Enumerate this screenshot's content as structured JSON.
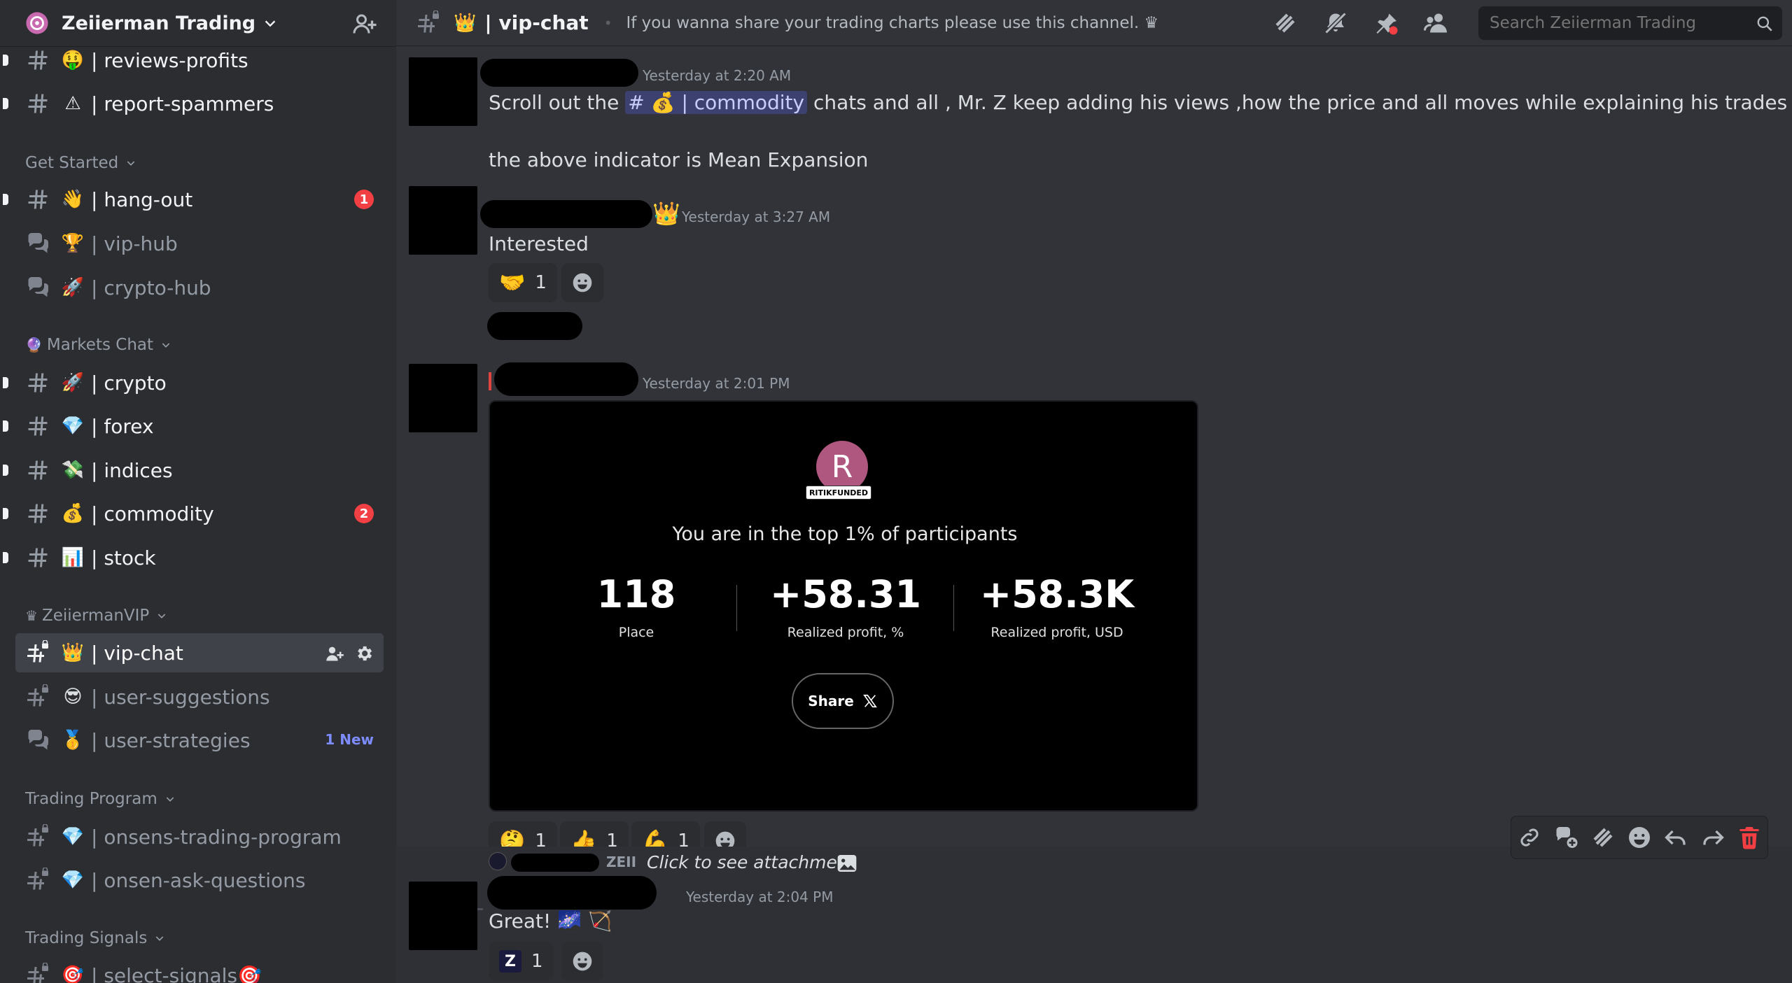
{
  "server": {
    "name": "Zeiierman Trading"
  },
  "sidebar": {
    "channels": [
      {
        "emoji": "🤑",
        "name": "| reviews-profits"
      },
      {
        "emoji": "⚠",
        "name": "| report-spammers"
      },
      {
        "emoji": "👋",
        "name": "| hang-out",
        "badge": "1"
      },
      {
        "emoji": "🏆",
        "name": "| vip-hub"
      },
      {
        "emoji": "🚀",
        "name": "| crypto-hub"
      },
      {
        "emoji": "🚀",
        "name": "| crypto"
      },
      {
        "emoji": "💎",
        "name": "| forex"
      },
      {
        "emoji": "💸",
        "name": "| indices"
      },
      {
        "emoji": "💰",
        "name": "| commodity",
        "badge": "2"
      },
      {
        "emoji": "📊",
        "name": "| stock"
      },
      {
        "emoji": "👑",
        "name": "| vip-chat"
      },
      {
        "emoji": "😎",
        "name": "| user-suggestions"
      },
      {
        "emoji": "🥇",
        "name": "| user-strategies",
        "new_label": "1 New"
      },
      {
        "emoji": "💎",
        "name": "| onsens-trading-program"
      },
      {
        "emoji": "💎",
        "name": "| onsen-ask-questions"
      },
      {
        "emoji": "🎯",
        "name": "| select-signals🎯"
      }
    ],
    "categories": [
      {
        "name": "Get Started"
      },
      {
        "emoji": "🔮",
        "name": "Markets Chat"
      },
      {
        "emoji": "♛",
        "name": "ZeiiermanVIP"
      },
      {
        "name": "Trading Program"
      },
      {
        "name": "Trading Signals"
      }
    ]
  },
  "topbar": {
    "emoji": "👑",
    "channel": "| vip-chat",
    "topic": "If you wanna share your trading charts please use this channel. ♛",
    "search_placeholder": "Search Zeiierman Trading"
  },
  "messages": {
    "m1": {
      "time": "Yesterday at 2:20 AM",
      "text_before": "Scroll out the",
      "mention_hash": "#",
      "mention_emoji": "💰",
      "mention_name": "| commodity",
      "text_after": "chats and all , Mr. Z keep adding his views ,how the price and all moves while explaining his trades",
      "line2": "the above indicator is Mean Expansion"
    },
    "m2": {
      "crown": "👑",
      "time": "Yesterday at 3:27 AM",
      "text": "Interested",
      "reactions": [
        {
          "emoji": "🤝",
          "count": "1"
        }
      ]
    },
    "m3": {
      "time": "Yesterday at 2:01 PM",
      "card": {
        "avatar_letter": "R",
        "tag": "RITIKFUNDED",
        "headline": "You are in the top 1% of participants",
        "stats": [
          {
            "value": "118",
            "label": "Place"
          },
          {
            "value": "+58.31",
            "label": "Realized profit, %"
          },
          {
            "value": "+58.3K",
            "label": "Realized profit, USD"
          }
        ],
        "share_label": "Share"
      },
      "reactions": [
        {
          "emoji": "🤔",
          "count": "1"
        },
        {
          "emoji": "👍",
          "count": "1"
        },
        {
          "emoji": "💪",
          "count": "1"
        }
      ]
    },
    "m4": {
      "reply_tag": "ZEII",
      "reply_text": "Click to see attachment",
      "time": "Yesterday at 2:04 PM",
      "text": "Great! 🌌 🏹",
      "reactions": [
        {
          "emoji": "Z",
          "count": "1"
        }
      ]
    }
  },
  "colors": {
    "badge": "#f23f43",
    "new_label": "#7d8cff",
    "delete": "#f23f43",
    "mention_bg": "#3c4270"
  }
}
